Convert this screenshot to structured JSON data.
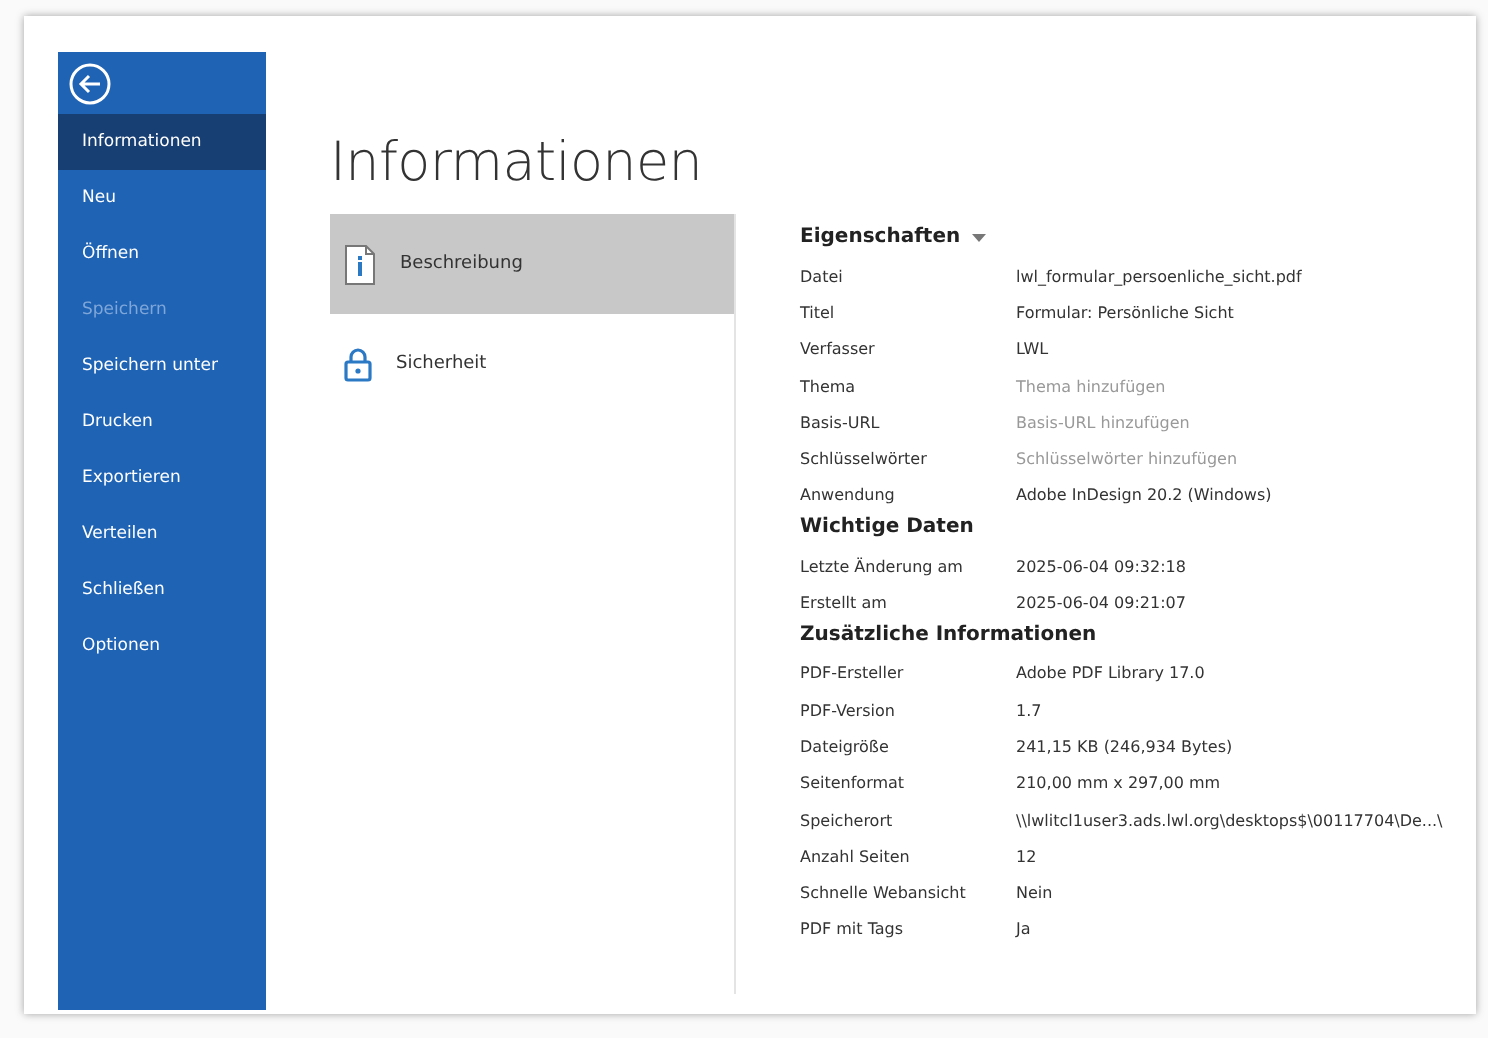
{
  "sidebar": {
    "items": [
      {
        "label": "Informationen",
        "selected": true,
        "disabled": false
      },
      {
        "label": "Neu",
        "selected": false,
        "disabled": false
      },
      {
        "label": "Öffnen",
        "selected": false,
        "disabled": false
      },
      {
        "label": "Speichern",
        "selected": false,
        "disabled": true
      },
      {
        "label": "Speichern unter",
        "selected": false,
        "disabled": false
      },
      {
        "label": "Drucken",
        "selected": false,
        "disabled": false
      },
      {
        "label": "Exportieren",
        "selected": false,
        "disabled": false
      },
      {
        "label": "Verteilen",
        "selected": false,
        "disabled": false
      },
      {
        "label": "Schließen",
        "selected": false,
        "disabled": false
      },
      {
        "label": "Optionen",
        "selected": false,
        "disabled": false
      }
    ]
  },
  "page_title": "Informationen",
  "sections": [
    {
      "label": "Beschreibung",
      "kind": "document",
      "selected": true
    },
    {
      "label": "Sicherheit",
      "kind": "lock",
      "selected": false
    }
  ],
  "properties": [
    {
      "heading": "Eigenschaften",
      "dropdown": true,
      "rows": [
        {
          "label": "Datei",
          "value": "lwl_formular_persoenliche_sicht.pdf"
        },
        {
          "label": "Titel",
          "value": "Formular: Persönliche Sicht"
        },
        {
          "label": "Verfasser",
          "value": "LWL"
        },
        {
          "label": "Thema",
          "placeholder": "Thema hinzufügen"
        },
        {
          "label": "Basis-URL",
          "placeholder": "Basis-URL hinzufügen"
        },
        {
          "label": "Schlüsselwörter",
          "placeholder": "Schlüsselwörter hinzufügen"
        },
        {
          "label": "Anwendung",
          "value": "Adobe InDesign 20.2 (Windows)"
        }
      ]
    },
    {
      "heading": "Wichtige Daten",
      "dropdown": false,
      "rows": [
        {
          "label": "Letzte Änderung am",
          "value": "2025-06-04 09:32:18"
        },
        {
          "label": "Erstellt am",
          "value": "2025-06-04 09:21:07"
        }
      ]
    },
    {
      "heading": "Zusätzliche Informationen",
      "dropdown": false,
      "rows": [
        {
          "label": "PDF-Ersteller",
          "value": "Adobe PDF Library 17.0"
        },
        {
          "label": "PDF-Version",
          "value": "1.7"
        },
        {
          "label": "Dateigröße",
          "value": "241,15 KB (246,934 Bytes)"
        },
        {
          "label": "Seitenformat",
          "value": "210,00 mm x 297,00 mm"
        },
        {
          "label": "Speicherort",
          "value": "\\\\lwlitcl1user3.ads.lwl.org\\desktops$\\00117704\\De...\\"
        },
        {
          "label": "Anzahl Seiten",
          "value": "12"
        },
        {
          "label": "Schnelle Webansicht",
          "value": "Nein"
        },
        {
          "label": "PDF mit Tags",
          "value": "Ja"
        }
      ]
    }
  ]
}
